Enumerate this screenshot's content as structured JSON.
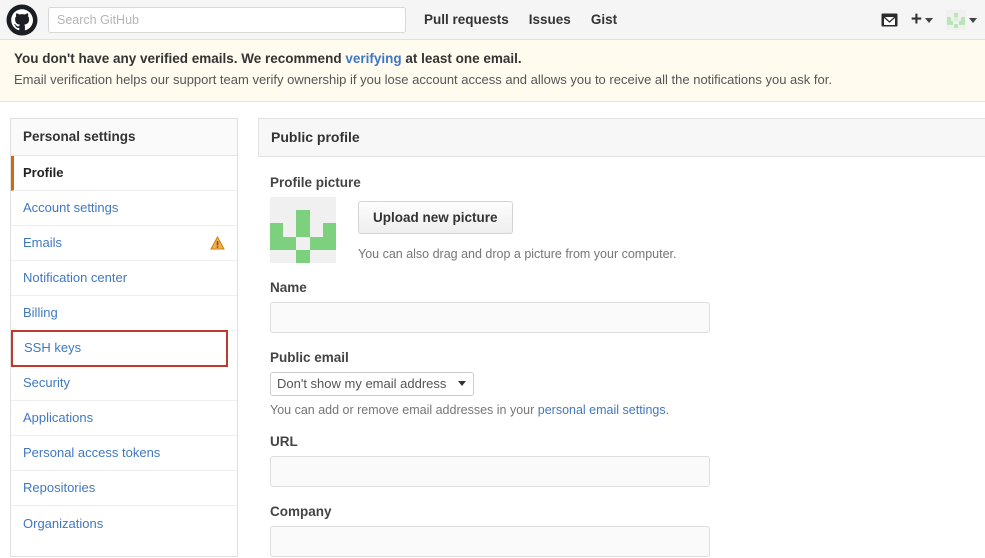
{
  "header": {
    "logo_icon": "github-octocat-logo",
    "search": {
      "placeholder": "Search GitHub",
      "value": ""
    },
    "nav": [
      {
        "label": "Pull requests"
      },
      {
        "label": "Issues"
      },
      {
        "label": "Gist"
      }
    ],
    "icons": [
      {
        "name": "notifications-inbox-icon"
      },
      {
        "name": "plus-icon"
      },
      {
        "name": "user-avatar-icon"
      }
    ]
  },
  "banner": {
    "line1_before": "You don't have any verified emails. We recommend ",
    "line1_link": "verifying",
    "line1_after": " at least one email.",
    "line2": "Email verification helps our support team verify ownership if you lose account access and allows you to receive all the notifications you ask for.",
    "background": "#fffbef",
    "link_color": "#4078c0"
  },
  "sidebar": {
    "title": "Personal settings",
    "items": [
      {
        "label": "Profile",
        "active": true
      },
      {
        "label": "Account settings",
        "active": false
      },
      {
        "label": "Emails",
        "active": false,
        "badge": "warning-triangle-icon"
      },
      {
        "label": "Notification center",
        "active": false
      },
      {
        "label": "Billing",
        "active": false
      },
      {
        "label": "SSH keys",
        "active": false,
        "highlighted": true
      },
      {
        "label": "Security",
        "active": false
      },
      {
        "label": "Applications",
        "active": false
      },
      {
        "label": "Personal access tokens",
        "active": false
      },
      {
        "label": "Repositories",
        "active": false
      },
      {
        "label": "Organizations",
        "active": false
      }
    ],
    "active_accent": "#d26911",
    "highlight_color": "#c0392b",
    "link_color": "#4078c0"
  },
  "main": {
    "title": "Public profile",
    "profile_picture": {
      "label": "Profile picture",
      "upload_button": "Upload new picture",
      "drag_hint": "You can also drag and drop a picture from your computer.",
      "identicon_color": "#7dd07d",
      "identicon_bg": "#f0f0f0",
      "identicon_grid": [
        [
          0,
          0,
          0,
          0,
          0
        ],
        [
          0,
          0,
          1,
          0,
          0
        ],
        [
          1,
          0,
          1,
          0,
          1
        ],
        [
          1,
          1,
          0,
          1,
          1
        ],
        [
          0,
          0,
          1,
          0,
          0
        ]
      ]
    },
    "name_field": {
      "label": "Name",
      "value": "",
      "placeholder": ""
    },
    "public_email": {
      "label": "Public email",
      "selected": "Don't show my email address",
      "options": [
        "Don't show my email address"
      ],
      "hint_before": "You can add or remove email addresses in your ",
      "hint_link": "personal email settings",
      "hint_after": "."
    },
    "url_field": {
      "label": "URL",
      "value": "",
      "placeholder": ""
    },
    "company_field": {
      "label": "Company",
      "value": "",
      "placeholder": ""
    }
  }
}
